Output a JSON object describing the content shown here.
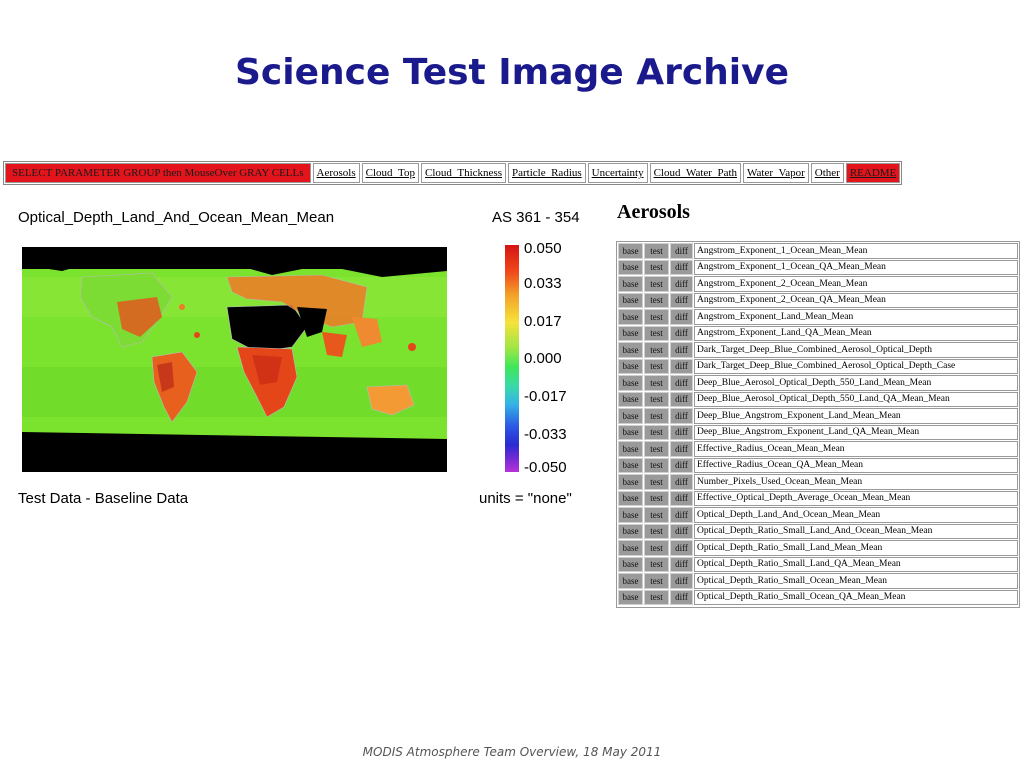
{
  "slide": {
    "title": "Science Test Image Archive",
    "footer": "MODIS Atmosphere Team Overview, 18 May 2011"
  },
  "navbar": {
    "prompt": "SELECT PARAMETER GROUP then MouseOver GRAY CELLs",
    "groups": [
      "Aerosols",
      "Cloud_Top",
      "Cloud_Thickness",
      "Particle_Radius",
      "Uncertainty",
      "Cloud_Water_Path",
      "Water_Vapor",
      "Other"
    ],
    "readme": "README"
  },
  "map_panel": {
    "title": "Optical_Depth_Land_And_Ocean_Mean_Mean",
    "code": "AS 361 - 354",
    "colorbar_labels": [
      "0.050",
      "0.033",
      "0.017",
      "0.000",
      "-0.017",
      "-0.033",
      "-0.050"
    ],
    "caption": "Test Data - Baseline Data",
    "units": "units = \"none\""
  },
  "params": {
    "group_title": "Aerosols",
    "button_labels": {
      "base": "base",
      "test": "test",
      "diff": "diff"
    },
    "items": [
      "Angstrom_Exponent_1_Ocean_Mean_Mean",
      "Angstrom_Exponent_1_Ocean_QA_Mean_Mean",
      "Angstrom_Exponent_2_Ocean_Mean_Mean",
      "Angstrom_Exponent_2_Ocean_QA_Mean_Mean",
      "Angstrom_Exponent_Land_Mean_Mean",
      "Angstrom_Exponent_Land_QA_Mean_Mean",
      "Dark_Target_Deep_Blue_Combined_Aerosol_Optical_Depth",
      "Dark_Target_Deep_Blue_Combined_Aerosol_Optical_Depth_Case",
      "Deep_Blue_Aerosol_Optical_Depth_550_Land_Mean_Mean",
      "Deep_Blue_Aerosol_Optical_Depth_550_Land_QA_Mean_Mean",
      "Deep_Blue_Angstrom_Exponent_Land_Mean_Mean",
      "Deep_Blue_Angstrom_Exponent_Land_QA_Mean_Mean",
      "Effective_Radius_Ocean_Mean_Mean",
      "Effective_Radius_Ocean_QA_Mean_Mean",
      "Number_Pixels_Used_Ocean_Mean_Mean",
      "Effective_Optical_Depth_Average_Ocean_Mean_Mean",
      "Optical_Depth_Land_And_Ocean_Mean_Mean",
      "Optical_Depth_Ratio_Small_Land_And_Ocean_Mean_Mean",
      "Optical_Depth_Ratio_Small_Land_Mean_Mean",
      "Optical_Depth_Ratio_Small_Land_QA_Mean_Mean",
      "Optical_Depth_Ratio_Small_Ocean_Mean_Mean",
      "Optical_Depth_Ratio_Small_Ocean_QA_Mean_Mean"
    ]
  },
  "colors": {
    "title": "#1a1a8c",
    "nav_highlight": "#e3141c",
    "button_gray": "#9a9a9a",
    "map_green": "#7be22e",
    "map_orange": "#f06a1e"
  }
}
